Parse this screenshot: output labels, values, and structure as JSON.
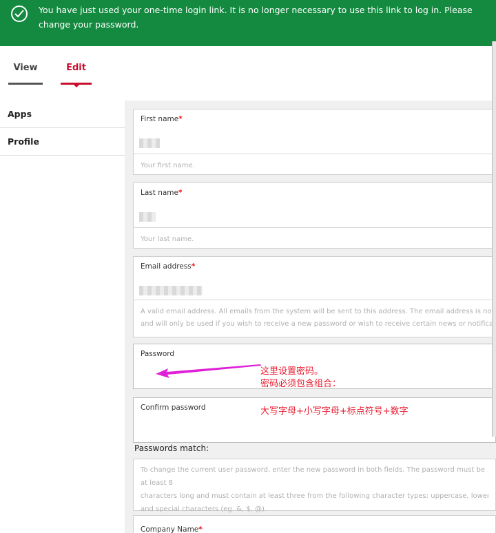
{
  "banner": {
    "message": "You have just used your one-time login link. It is no longer necessary to use this link to log in. Please change your password.",
    "color": "#138a3f"
  },
  "tabs": [
    {
      "label": "View",
      "active": false
    },
    {
      "label": "Edit",
      "active": true
    }
  ],
  "sidebar": {
    "items": [
      {
        "label": "Apps"
      },
      {
        "label": "Profile"
      }
    ]
  },
  "form": {
    "first_name": {
      "label": "First name",
      "required_mark": "*",
      "description": "Your first name."
    },
    "last_name": {
      "label": "Last name",
      "required_mark": "*",
      "description": "Your last name."
    },
    "email": {
      "label": "Email address",
      "required_mark": "*",
      "description_line1": "A valid email address. All emails from the system will be sent to this address. The email address is not made publi",
      "description_line2": "and will only be used if you wish to receive a new password or wish to receive certain news or notifications by e"
    },
    "password": {
      "label": "Password"
    },
    "confirm_password": {
      "label": "Confirm password"
    },
    "passwords_match": "Passwords match:",
    "password_help": {
      "line1": "To change the current user password, enter the new password in both fields. The password must be at least 8",
      "line2": "characters long and must contain at least three from the following character types: uppercase, lowercase, nume",
      "line3": "and special characters (eg. &, $, @)."
    },
    "company_name": {
      "label": "Company Name",
      "required_mark": "*"
    }
  },
  "annotations": {
    "line1": "这里设置密码。",
    "line2": "密码必须包含组合：",
    "line3": "大写字母+小写字母+标点符号+数字",
    "color": "#e8192c",
    "arrow_color": "#e020d8"
  }
}
